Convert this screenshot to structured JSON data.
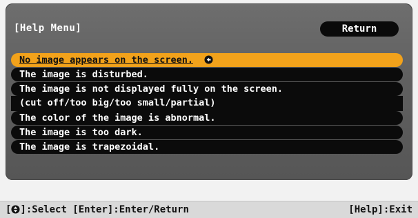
{
  "menu": {
    "title": "[Help Menu]",
    "return_label": "Return",
    "items": [
      {
        "label": "No image appears on the screen.",
        "selected": true
      },
      {
        "label": "The image is disturbed.",
        "selected": false
      },
      {
        "label": "The image is not displayed fully on the screen.",
        "selected": false
      },
      {
        "label": "(cut off/too big/too small/partial)",
        "selected": false
      },
      {
        "label": "The color of the image is abnormal.",
        "selected": false
      },
      {
        "label": "The image is too dark.",
        "selected": false
      },
      {
        "label": "The image is trapezoidal.",
        "selected": false
      }
    ],
    "selected_icon": "enter-arrow-icon"
  },
  "statusbar": {
    "select_prefix": "[",
    "select_icon": "up-down-arrow-icon",
    "select_text": "]:Select [Enter]:Enter/Return",
    "exit_text": "[Help]:Exit"
  },
  "colors": {
    "panel": "#626262",
    "item_bg": "#0b0b0b",
    "selected_bg": "#f2a21b",
    "statusbar_bg": "#d9d9d9"
  }
}
